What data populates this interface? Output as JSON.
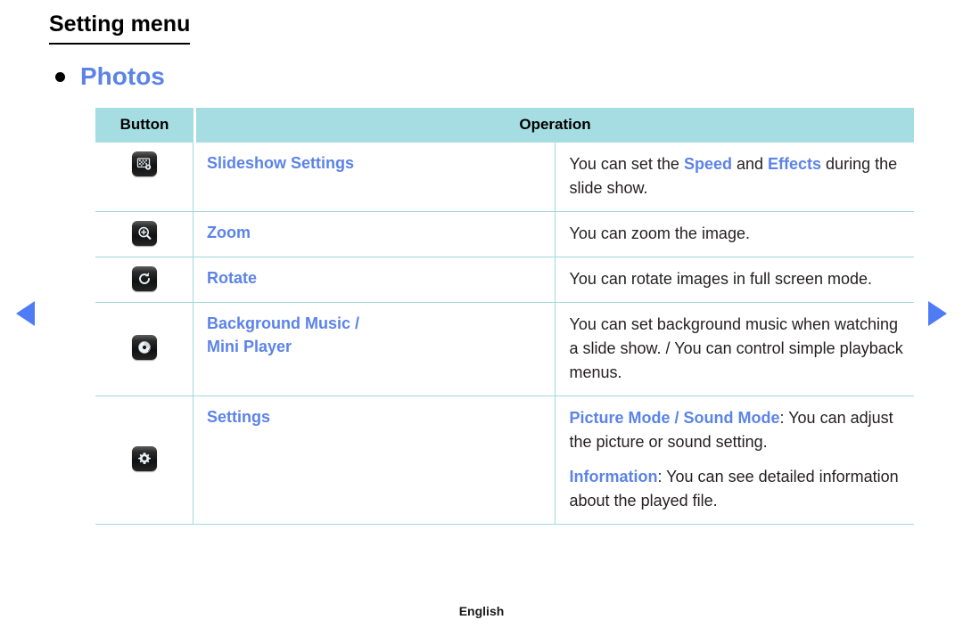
{
  "page": {
    "title": "Setting menu",
    "section_bullet_label": "Photos",
    "footer_language": "English",
    "accent_blue": "#5b83e8",
    "arrow_blue": "#4d7cf5",
    "table_header_bg": "#a6dde2",
    "table_border": "#9fd8dd"
  },
  "nav": {
    "prev_label": "Previous page",
    "next_label": "Next page"
  },
  "table": {
    "headers": {
      "button": "Button",
      "operation": "Operation"
    },
    "rows": [
      {
        "icon": "slideshow-settings-icon",
        "name": "Slideshow Settings",
        "operation_parts": [
          [
            {
              "t": "You can set the ",
              "hl": false
            },
            {
              "t": "Speed",
              "hl": true
            },
            {
              "t": " and ",
              "hl": false
            },
            {
              "t": "Effects",
              "hl": true
            },
            {
              "t": " during the slide show.",
              "hl": false
            }
          ]
        ]
      },
      {
        "icon": "zoom-in-icon",
        "name": "Zoom",
        "operation_parts": [
          [
            {
              "t": "You can zoom the image.",
              "hl": false
            }
          ]
        ]
      },
      {
        "icon": "rotate-icon",
        "name": "Rotate",
        "operation_parts": [
          [
            {
              "t": "You can rotate images in full screen mode.",
              "hl": false
            }
          ]
        ]
      },
      {
        "icon": "disc-music-icon",
        "name": "Background Music / Mini Player",
        "name_line1": "Background Music /",
        "name_line2": "Mini Player",
        "operation_parts": [
          [
            {
              "t": "You can set background music when watching a slide show. / You can control simple playback menus.",
              "hl": false
            }
          ]
        ]
      },
      {
        "icon": "gear-icon",
        "name": "Settings",
        "operation_parts": [
          [
            {
              "t": "Picture Mode / Sound Mode",
              "hl": true
            },
            {
              "t": ": You can adjust the picture or sound setting.",
              "hl": false
            }
          ],
          [
            {
              "t": "Information",
              "hl": true
            },
            {
              "t": ": You can see detailed information about the played file.",
              "hl": false
            }
          ]
        ]
      }
    ]
  }
}
